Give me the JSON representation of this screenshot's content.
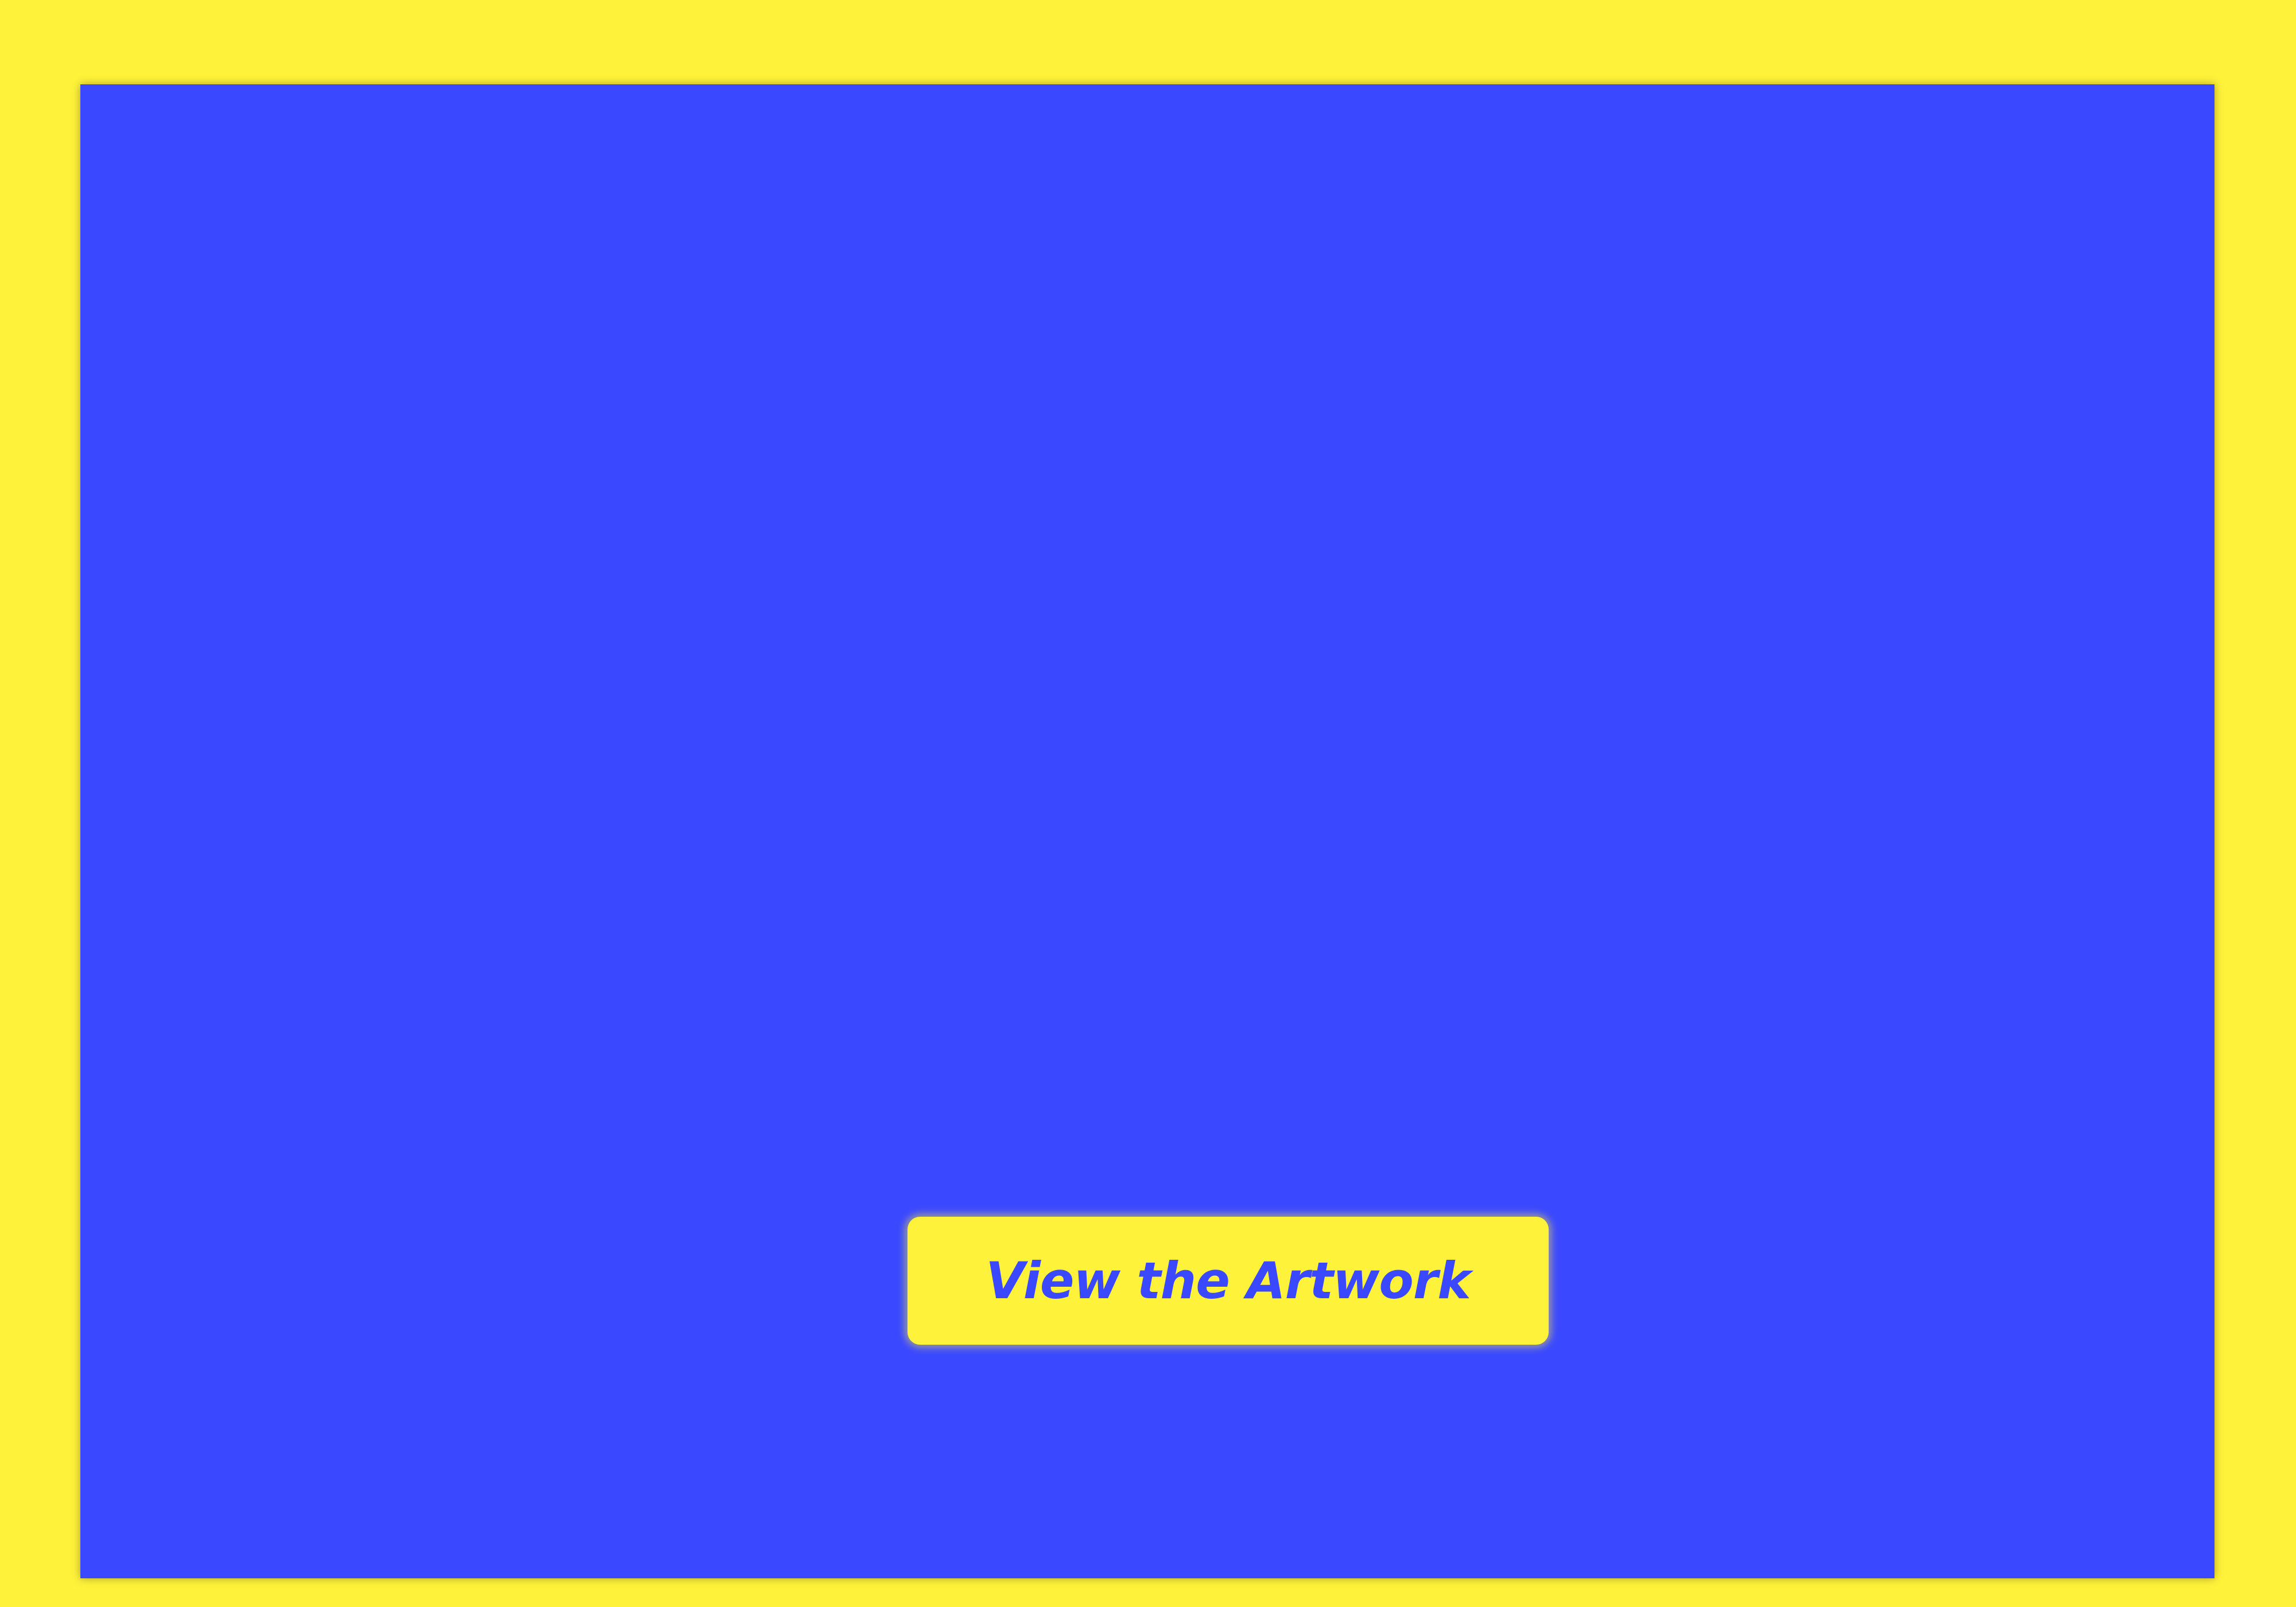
{
  "colors": {
    "background": "#fff23a",
    "panel": "#3a48ff",
    "button_bg": "#fff23a",
    "button_text": "#3a48ff"
  },
  "cta": {
    "label": "View the Artwork"
  }
}
